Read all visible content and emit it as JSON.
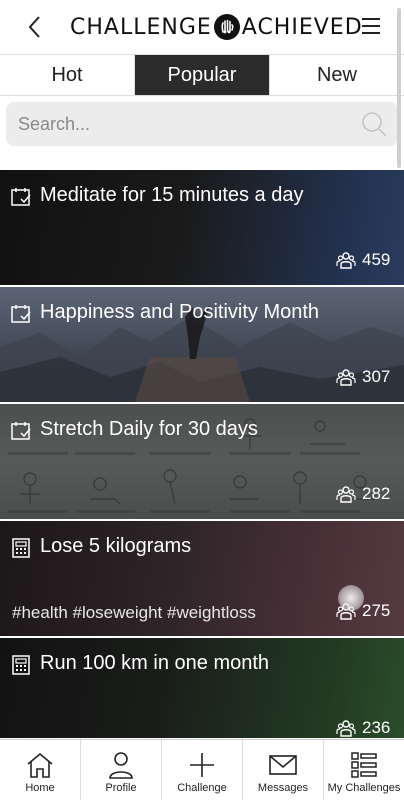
{
  "header": {
    "logo_left": "CHALLENGE",
    "logo_right": "ACHIEVED"
  },
  "tabs": [
    {
      "label": "Hot",
      "active": false
    },
    {
      "label": "Popular",
      "active": true
    },
    {
      "label": "New",
      "active": false
    }
  ],
  "search": {
    "placeholder": "Search..."
  },
  "challenges": [
    {
      "title": "Meditate for 15 minutes a day",
      "icon": "calendar-check-icon",
      "participants": "459",
      "tags": ""
    },
    {
      "title": "Happiness and Positivity Month",
      "icon": "calendar-check-icon",
      "participants": "307",
      "tags": ""
    },
    {
      "title": "Stretch Daily for 30 days",
      "icon": "calendar-check-icon",
      "participants": "282",
      "tags": ""
    },
    {
      "title": "Lose 5 kilograms",
      "icon": "calculator-icon",
      "participants": "275",
      "tags": "#health  #loseweight  #weightloss"
    },
    {
      "title": "Run 100 km in one month",
      "icon": "calculator-icon",
      "participants": "236",
      "tags": ""
    }
  ],
  "bottom_nav": [
    {
      "label": "Home",
      "icon": "home-icon"
    },
    {
      "label": "Profile",
      "icon": "profile-icon"
    },
    {
      "label": "Challenge",
      "icon": "plus-icon"
    },
    {
      "label": "Messages",
      "icon": "envelope-icon"
    },
    {
      "label": "My Challenges",
      "icon": "list-icon"
    }
  ],
  "colors": {
    "active_tab": "#2b2b2b",
    "search_bg": "#ececec"
  }
}
